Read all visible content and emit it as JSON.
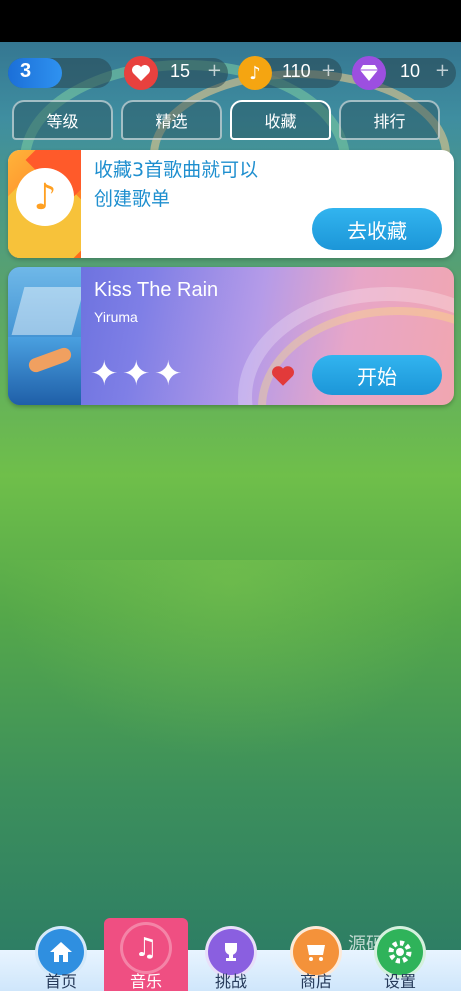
{
  "topbar": {
    "level": "3",
    "lives": "15",
    "notes": "110",
    "gems": "10",
    "plus": "+"
  },
  "tabs": [
    {
      "label": "等级",
      "active": false
    },
    {
      "label": "精选",
      "active": false
    },
    {
      "label": "收藏",
      "active": true
    },
    {
      "label": "排行",
      "active": false
    }
  ],
  "collect_card": {
    "line1": "收藏3首歌曲就可以",
    "line2": "创建歌单",
    "button": "去收藏"
  },
  "song_card": {
    "title": "Kiss The Rain",
    "artist": "Yiruma",
    "stars": 3,
    "star_glyph": "✦",
    "favorited": true,
    "button": "开始"
  },
  "bottom_nav": [
    {
      "label": "首页",
      "icon": "home-icon",
      "color": "#2f8fe0"
    },
    {
      "label": "音乐",
      "icon": "music-note-icon",
      "color": "#ef4f82",
      "active": true
    },
    {
      "label": "挑战",
      "icon": "trophy-icon",
      "color": "#8a5fe0"
    },
    {
      "label": "商店",
      "icon": "shop-icon",
      "color": "#f4923a"
    },
    {
      "label": "设置",
      "icon": "gear-icon",
      "color": "#2fb35a"
    }
  ],
  "watermark": "源码天"
}
